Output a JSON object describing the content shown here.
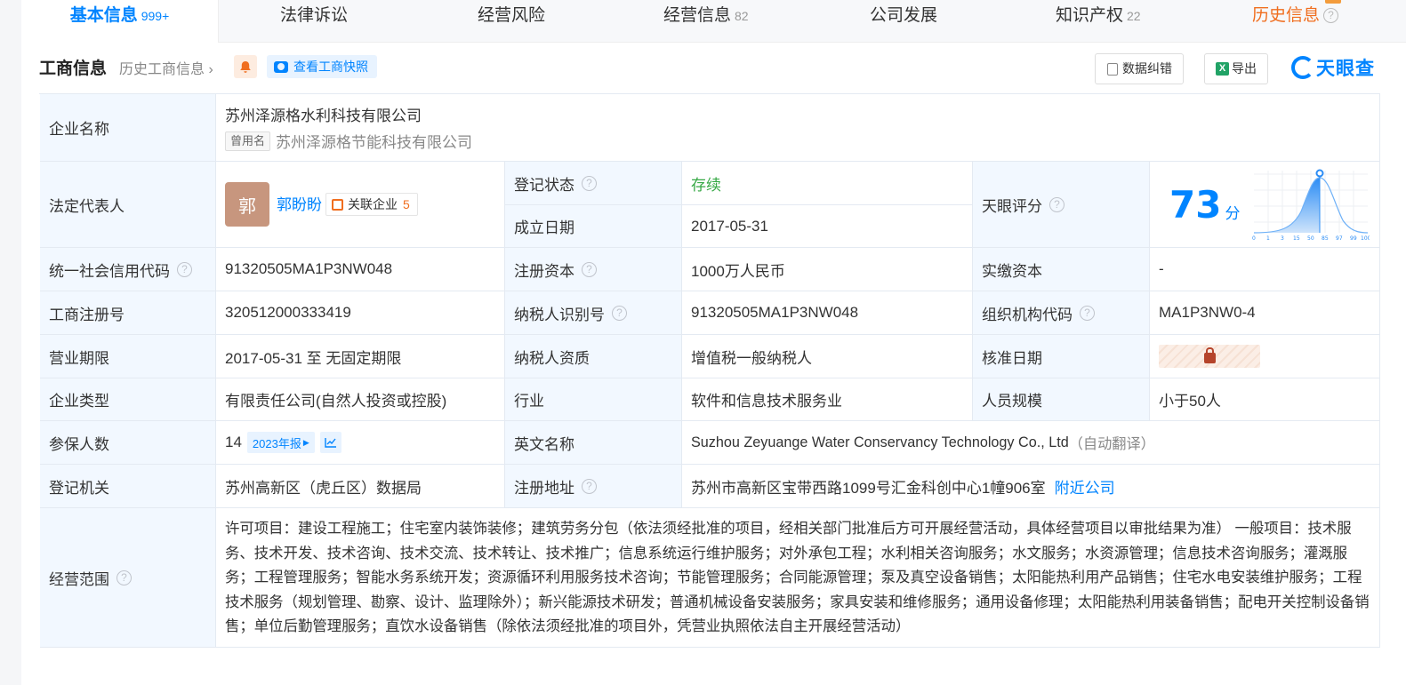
{
  "tabs": [
    {
      "label": "基本信息",
      "count": "999+"
    },
    {
      "label": "法律诉讼",
      "count": ""
    },
    {
      "label": "经营风险",
      "count": ""
    },
    {
      "label": "经营信息",
      "count": "82"
    },
    {
      "label": "公司发展",
      "count": ""
    },
    {
      "label": "知识产权",
      "count": "22"
    },
    {
      "label": "历史信息",
      "count": ""
    }
  ],
  "header": {
    "title": "工商信息",
    "history_link": "历史工商信息",
    "snapshot_label": "查看工商快照",
    "correct_label": "数据纠错",
    "export_label": "导出",
    "brand": "天眼查"
  },
  "labels": {
    "company_name": "企业名称",
    "legal_rep": "法定代表人",
    "reg_status": "登记状态",
    "found_date": "成立日期",
    "tianyan_score": "天眼评分",
    "credit_code": "统一社会信用代码",
    "reg_capital": "注册资本",
    "paid_capital": "实缴资本",
    "reg_number": "工商注册号",
    "taxpayer_id": "纳税人识别号",
    "org_code": "组织机构代码",
    "biz_term": "营业期限",
    "taxpayer_qual": "纳税人资质",
    "approve_date": "核准日期",
    "company_type": "企业类型",
    "industry": "行业",
    "staff_size": "人员规模",
    "insured": "参保人数",
    "english_name": "英文名称",
    "reg_authority": "登记机关",
    "reg_address": "注册地址",
    "biz_scope": "经营范围"
  },
  "values": {
    "company_name": "苏州泽源格水利科技有限公司",
    "former_tag": "曾用名",
    "former_name": "苏州泽源格节能科技有限公司",
    "avatar_char": "郭",
    "legal_rep": "郭盼盼",
    "assoc_label": "关联企业",
    "assoc_count": "5",
    "reg_status": "存续",
    "found_date": "2017-05-31",
    "score": "73",
    "score_unit": "分",
    "credit_code": "91320505MA1P3NW048",
    "reg_capital": "1000万人民币",
    "paid_capital": "-",
    "reg_number": "320512000333419",
    "taxpayer_id": "91320505MA1P3NW048",
    "org_code": "MA1P3NW0-4",
    "biz_term": "2017-05-31 至 无固定期限",
    "taxpayer_qual": "增值税一般纳税人",
    "company_type": "有限责任公司(自然人投资或控股)",
    "industry": "软件和信息技术服务业",
    "staff_size": "小于50人",
    "insured": "14",
    "insured_year": "2023年报",
    "english_name": "Suzhou Zeyuange Water Conservancy Technology Co., Ltd",
    "auto_translate": "（自动翻译）",
    "reg_authority": "苏州高新区（虎丘区）数据局",
    "reg_address": "苏州市高新区宝带西路1099号汇金科创中心1幢906室",
    "nearby": "附近公司",
    "biz_scope": "许可项目：建设工程施工；住宅室内装饰装修；建筑劳务分包（依法须经批准的项目，经相关部门批准后方可开展经营活动，具体经营项目以审批结果为准） 一般项目：技术服务、技术开发、技术咨询、技术交流、技术转让、技术推广；信息系统运行维护服务；对外承包工程；水利相关咨询服务；水文服务；水资源管理；信息技术咨询服务；灌溉服务；工程管理服务；智能水务系统开发；资源循环利用服务技术咨询；节能管理服务；合同能源管理；泵及真空设备销售；太阳能热利用产品销售；住宅水电安装维护服务；工程技术服务（规划管理、勘察、设计、监理除外）；新兴能源技术研发；普通机械设备安装服务；家具安装和维修服务；通用设备修理；太阳能热利用装备销售；配电开关控制设备销售；单位后勤管理服务；直饮水设备销售（除依法须经批准的项目外，凭营业执照依法自主开展经营活动）"
  },
  "score_chart": {
    "ticks": [
      "0",
      "1",
      "3",
      "15",
      "50",
      "85",
      "97",
      "99",
      "100"
    ]
  },
  "colors": {
    "accent": "#0084ff",
    "status_green": "#37a946",
    "history_orange": "#f06e1f",
    "label_bg": "#f2f8ff"
  }
}
